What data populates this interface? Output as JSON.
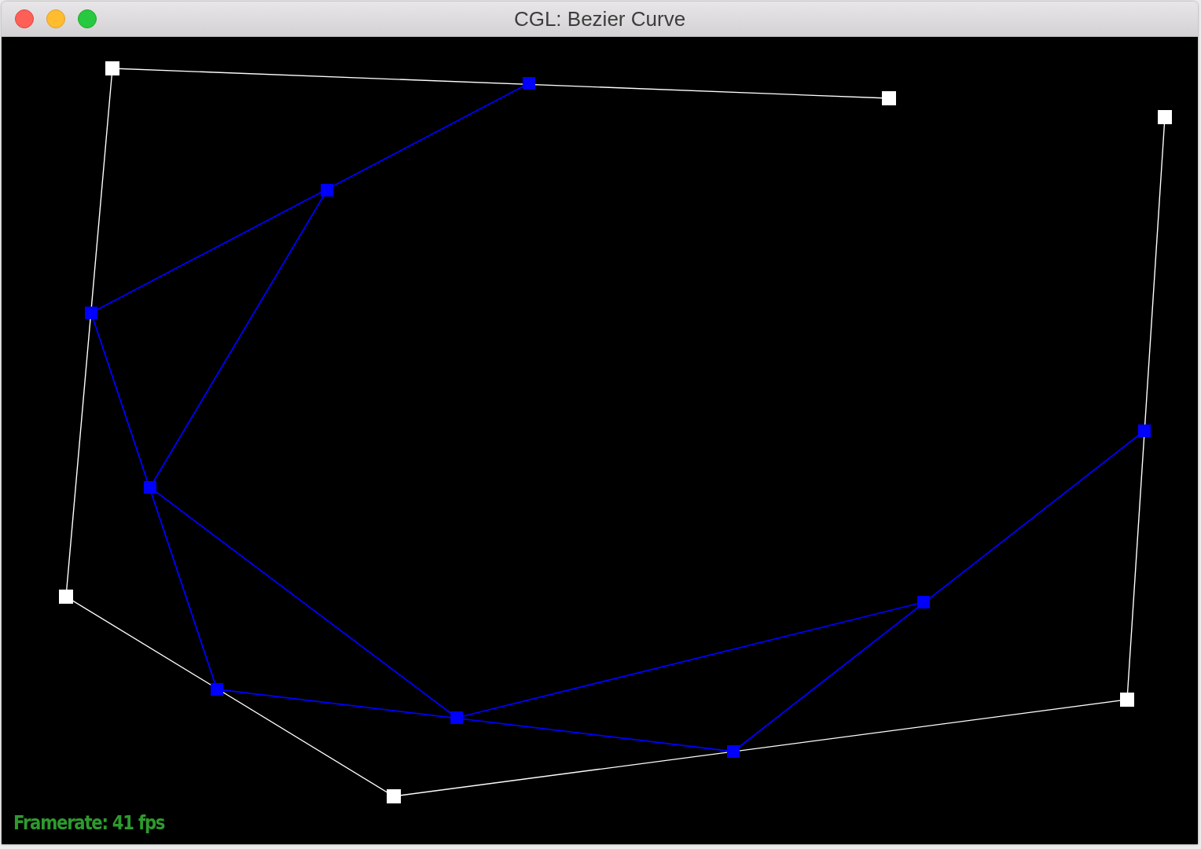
{
  "window": {
    "title": "CGL: Bezier Curve"
  },
  "levels": [
    {
      "kind": "control",
      "color": "#ffffff"
    },
    {
      "kind": "intermediate",
      "color": "#0000ff"
    },
    {
      "kind": "intermediate",
      "color": "#0000ff"
    }
  ],
  "status": {
    "framerate": "Framerate: 41 fps"
  }
}
